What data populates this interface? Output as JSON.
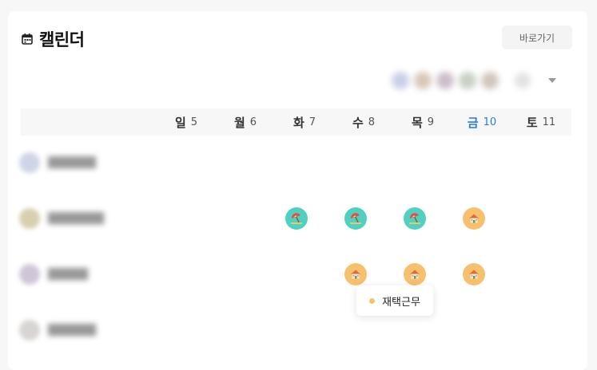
{
  "header": {
    "title": "캘린더",
    "goto_label": "바로가기"
  },
  "days": [
    {
      "weekday": "일",
      "date": "5",
      "today": false
    },
    {
      "weekday": "월",
      "date": "6",
      "today": false
    },
    {
      "weekday": "화",
      "date": "7",
      "today": false
    },
    {
      "weekday": "수",
      "date": "8",
      "today": false
    },
    {
      "weekday": "목",
      "date": "9",
      "today": false
    },
    {
      "weekday": "금",
      "date": "10",
      "today": true
    },
    {
      "weekday": "토",
      "date": "11",
      "today": false
    }
  ],
  "event_types": {
    "vacation": {
      "icon": "beach-umbrella-icon",
      "color": "#4fd0c1"
    },
    "wfh": {
      "icon": "house-icon",
      "color": "#f7c06d"
    }
  },
  "members": [
    {
      "events": []
    },
    {
      "events": [
        {
          "day": 2,
          "type": "vacation"
        },
        {
          "day": 3,
          "type": "vacation"
        },
        {
          "day": 4,
          "type": "vacation"
        },
        {
          "day": 5,
          "type": "wfh"
        }
      ]
    },
    {
      "events": [
        {
          "day": 3,
          "type": "wfh"
        },
        {
          "day": 4,
          "type": "wfh"
        },
        {
          "day": 5,
          "type": "wfh"
        }
      ]
    },
    {
      "events": []
    }
  ],
  "tooltip": {
    "label": "재택근무"
  }
}
